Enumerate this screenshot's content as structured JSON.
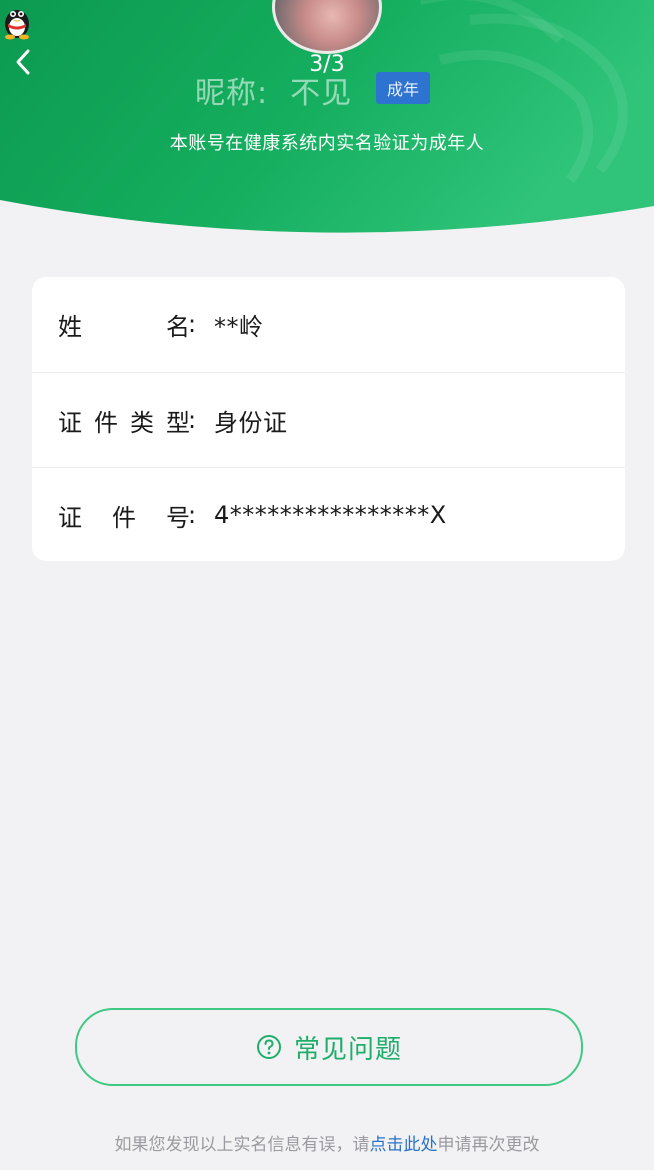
{
  "header": {
    "counter": "3/3",
    "nickname_label": "昵称:",
    "nickname_value": "不见",
    "badge": "成年",
    "note": "本账号在健康系统内实名验证为成年人",
    "colors": {
      "green_dark": "#0f9d52",
      "green_light": "#2fc47a"
    }
  },
  "info": {
    "rows": [
      {
        "label_chars": [
          "姓",
          "名"
        ],
        "colon": ":",
        "value": "**岭"
      },
      {
        "label_chars": [
          "证",
          "件",
          "类",
          "型"
        ],
        "colon": ":",
        "value": "身份证"
      },
      {
        "label_chars": [
          "证",
          "件",
          "号"
        ],
        "colon": ":",
        "value": "4****************X"
      }
    ]
  },
  "faq": {
    "label": "常见问题",
    "icon": "question-circle-icon",
    "color": "#1fae6a"
  },
  "footer": {
    "prefix": "如果您发现以上实名信息有误，请",
    "link": "点击此处",
    "suffix": "申请再次更改",
    "link_color": "#2a73c6"
  }
}
